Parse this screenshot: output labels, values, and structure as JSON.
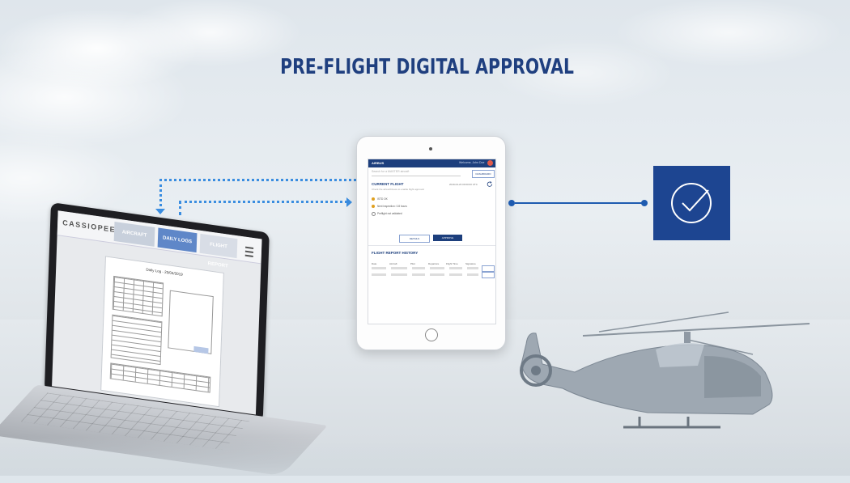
{
  "headline": "PRE-FLIGHT DIGITAL APPROVAL",
  "laptop": {
    "logo": "CASSIOPEE",
    "tabs": [
      "AIRCRAFT",
      "DAILY LOGS",
      "FLIGHT REPORT"
    ],
    "document_title": "Daily Log - 23/04/2019"
  },
  "tablet": {
    "header": {
      "brand": "AIRBUS",
      "user": "Welcome, John Doe"
    },
    "search_placeholder": "Search for a MASTER aircraft",
    "action_button": "DASHBOARD",
    "current_flight": {
      "title": "CURRENT FLIGHT",
      "subtitle": "Check the airworthiness to enable flight approval",
      "date": "2019-04-23 00:00:00 UTC",
      "items": [
        "ISTD OK",
        "Next inspection: 0.8 hours",
        "Preflight not validated"
      ],
      "buttons": [
        "DETAILS",
        "APPROVE"
      ]
    },
    "flight_report": {
      "title": "FLIGHT REPORT HISTORY",
      "columns": [
        "Date",
        "Aircraft",
        "Pilot",
        "Departure",
        "Flight Time",
        "Signature"
      ]
    }
  },
  "colors": {
    "brand_blue": "#1d4591",
    "title_blue": "#1f3f7f",
    "dotted_link": "#3a8de0"
  },
  "icons": [
    "check-circle-icon",
    "refresh-icon",
    "menu-icon"
  ]
}
